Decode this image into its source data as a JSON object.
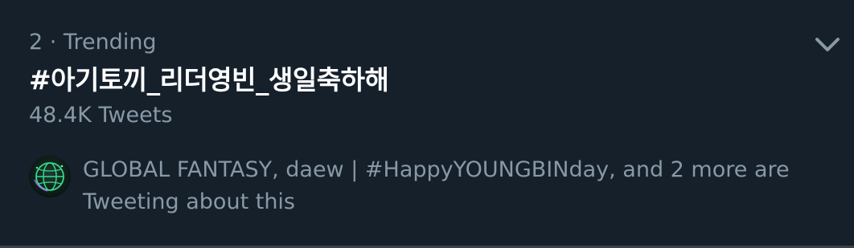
{
  "trend": {
    "meta": "2 · Trending",
    "hashtag": "#아기토끼_리더영빈_생일축하해",
    "tweet_count": "48.4K Tweets",
    "context": "GLOBAL FANTASY, daew | #HappyYOUNGBINday, and 2 more are Tweeting about this"
  },
  "icons": {
    "more": "chevron-down-icon",
    "avatar": "globe-avatar"
  },
  "colors": {
    "background": "#15202b",
    "primary_text": "#ffffff",
    "secondary_text": "#8899a6",
    "divider": "#38444d",
    "avatar_accent": "#39d98a"
  }
}
